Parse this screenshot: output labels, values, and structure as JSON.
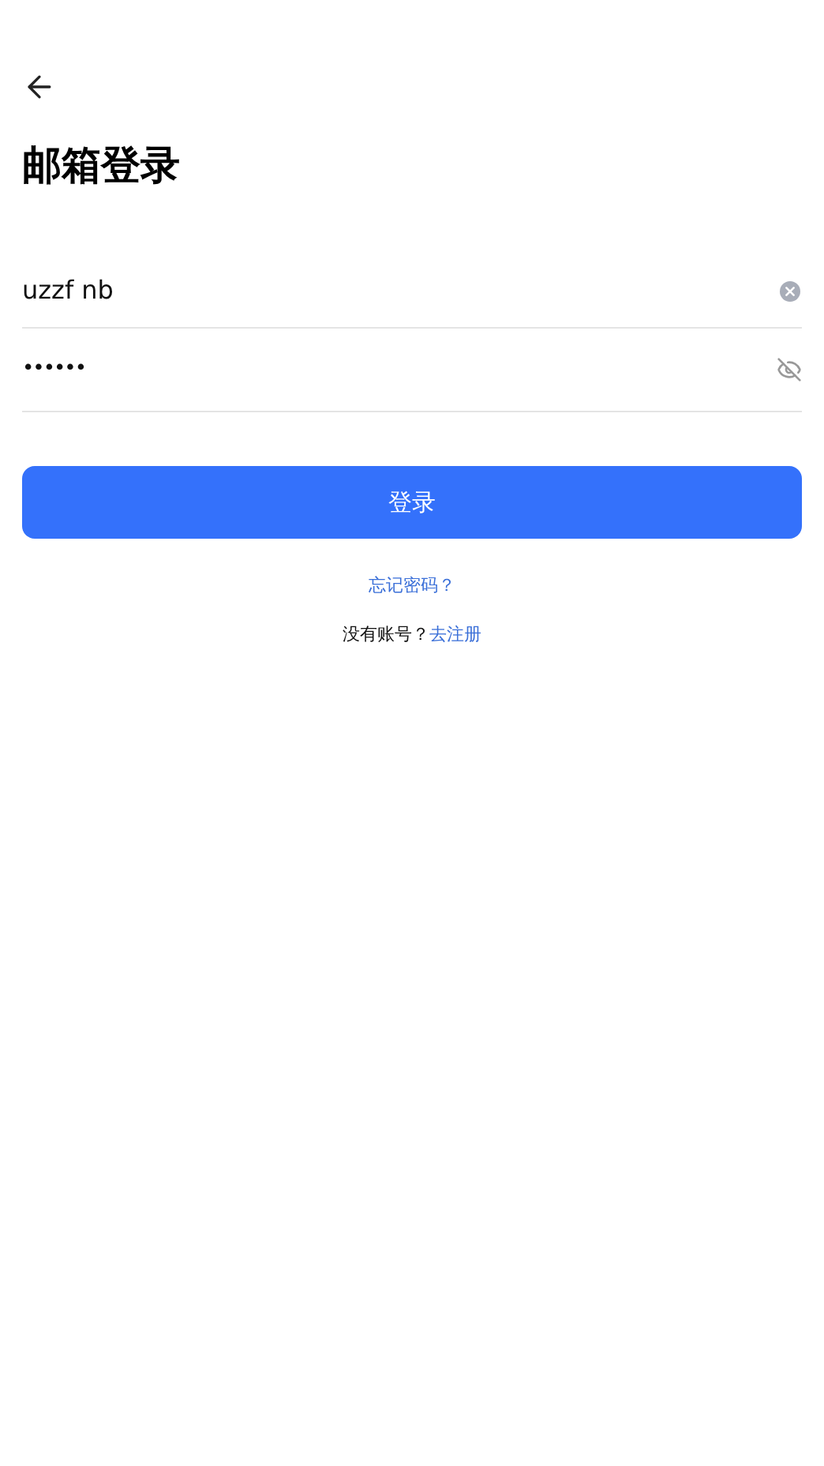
{
  "title": "邮箱登录",
  "email_field": {
    "value": "uzzf nb"
  },
  "password_field": {
    "value": "••••••",
    "visible": false
  },
  "login_button": {
    "label": "登录"
  },
  "forgot_link": "忘记密码？",
  "register": {
    "prompt": "没有账号？",
    "link": "去注册"
  }
}
